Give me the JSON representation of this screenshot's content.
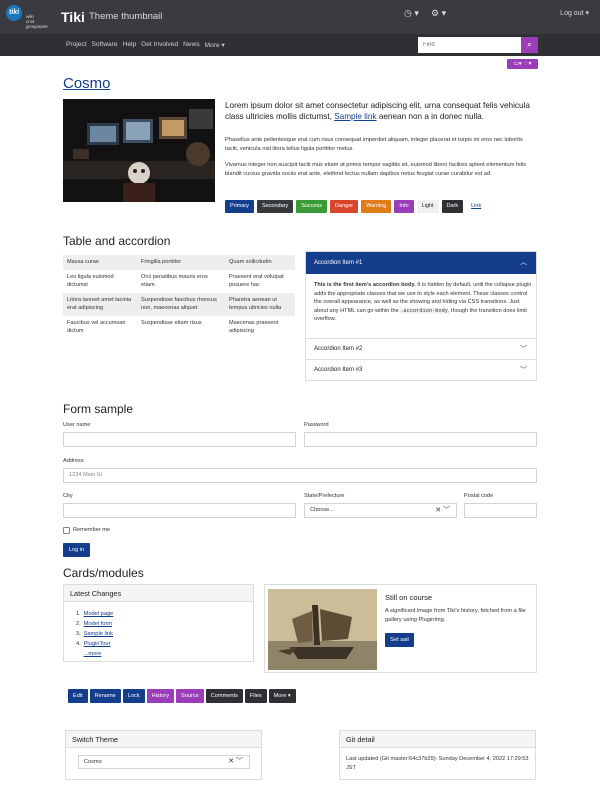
{
  "header": {
    "logo_mark": "tiki",
    "logo_sub": [
      "wiki",
      "cms",
      "groupware"
    ],
    "site_title": "Tiki",
    "page_subtitle": "Theme thumbnail",
    "logout_label": "Log out",
    "nav": [
      "Project",
      "Software",
      "Help",
      "Get Involved",
      "News",
      "More"
    ],
    "search_placeholder": "Find"
  },
  "hero": {
    "title": "Cosmo",
    "lead_text": "Lorem ipsum dolor sit amet consectetur adipiscing elit, urna consequat felis vehicula class ultricies mollis dictumst,",
    "lead_link": "Sample link",
    "lead_tail": "aenean non a in donec nulla.",
    "para1": "Phasellus ante pellentesque erat cum risus consequat imperdiet aliquam, integer placerat et turpis mi eros nec lobortis taciti, vehicula nisl litora tellus ligula porttitor metus.",
    "para2": "Vivamus integer non suscipit taciti mus etiam at primis tempor sagittis sit, euismod libero facilisis aptent elementum felis blandit cursus gravida sociis erat ante, eleifend lectus nullam dapibus netus feugiat curae curabitur est ad.",
    "buttons": [
      {
        "label": "Primary",
        "color": "#143d8c"
      },
      {
        "label": "Secondary",
        "color": "#373a3c"
      },
      {
        "label": "Success",
        "color": "#3a9a36"
      },
      {
        "label": "Danger",
        "color": "#d8442c"
      },
      {
        "label": "Warning",
        "color": "#e07b1a"
      },
      {
        "label": "Info",
        "color": "#9b3db8"
      },
      {
        "label": "Light",
        "color": "#f0f0f0"
      },
      {
        "label": "Dark",
        "color": "#2f3034"
      },
      {
        "label": "Link",
        "color": "#ffffff"
      }
    ]
  },
  "table_section": {
    "heading": "Table and accordion",
    "rows": [
      [
        "Massa curae",
        "Fringilla porttitor",
        "Quam sollicitudin"
      ],
      [
        "Leo ligula euismod dictumst",
        "Orci penatibus mauris eros etiam",
        "Praesent erat volutpat posuere hac"
      ],
      [
        "Litora laoreet amet lacinia erat adipiscing",
        "Suspendisse faucibus rhoncus non, maecenas aliquet",
        "Pharetra aenean ut tempus ultricies nulla"
      ],
      [
        "Faucibus vel accumsan dictum",
        "Suspendisse etiam risus",
        "Maecenas praesent adipiscing"
      ]
    ],
    "accordion": {
      "item1_title": "Accordion Item #1",
      "item1_bold": "This is the first item's accordion body.",
      "item1_body": "It is hidden by default, until the collapse plugin adds the appropriate classes that we use to style each element. These classes control the overall appearance, as well as the showing and hiding via CSS transitions. Just about any HTML can go within the",
      "item1_code": ".accordion-body",
      "item1_tail": ", though the transition does limit overflow.",
      "item2_title": "Accordion Item #2",
      "item3_title": "Accordion Item #3"
    }
  },
  "form": {
    "heading": "Form sample",
    "username_label": "User name",
    "password_label": "Password",
    "address_label": "Address",
    "address_placeholder": "1234 Main St",
    "city_label": "City",
    "state_label": "State/Prefecture",
    "state_value": "Choose...",
    "postal_label": "Postal code",
    "remember_label": "Remember me",
    "login_label": "Log in"
  },
  "cards": {
    "heading": "Cards/modules",
    "module_title": "Latest Changes",
    "changes": [
      "Model page",
      "Model form",
      "Sample link",
      "PluginTour"
    ],
    "more_label": "...more",
    "card_title": "Still on course",
    "card_text": "A significant image from Tiki's history, fetched from a file gallery using PluginImg.",
    "card_button": "Set sail"
  },
  "actions": [
    {
      "label": "Edit",
      "color": "#143d8c"
    },
    {
      "label": "Rename",
      "color": "#143d8c"
    },
    {
      "label": "Lock",
      "color": "#143d8c"
    },
    {
      "label": "History",
      "color": "#9b3db8"
    },
    {
      "label": "Source",
      "color": "#9b3db8"
    },
    {
      "label": "Comments",
      "color": "#2f3034"
    },
    {
      "label": "Files",
      "color": "#2f3034"
    },
    {
      "label": "More",
      "color": "#2f3034"
    }
  ],
  "switch_theme": {
    "title": "Switch Theme",
    "value": "Cosmo"
  },
  "git": {
    "title": "Git detail",
    "text": "Last updated (Git master:64c37b29): Sunday December 4, 2022 17:29:53 JST"
  }
}
